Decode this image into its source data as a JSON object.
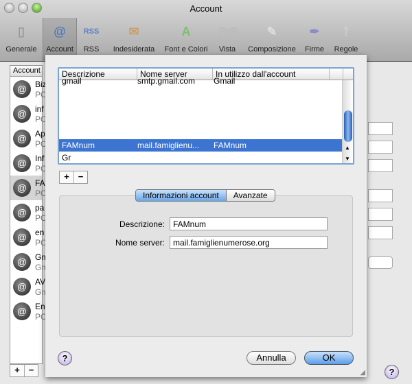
{
  "window": {
    "title": "Account"
  },
  "toolbar": [
    {
      "label": "Generale",
      "icon": "switch-icon",
      "glyph": "▯",
      "color": "#999"
    },
    {
      "label": "Account",
      "icon": "at-icon",
      "glyph": "@",
      "color": "#4a78c0",
      "selected": true
    },
    {
      "label": "RSS",
      "icon": "rss-icon",
      "glyph": "RSS",
      "color": "#5e7ec8"
    },
    {
      "label": "Indesiderata",
      "icon": "junk-bag-icon",
      "glyph": "✉",
      "color": "#c9a06a"
    },
    {
      "label": "Font e Colori",
      "icon": "font-colors-icon",
      "glyph": "A",
      "color": "#7cc06a"
    },
    {
      "label": "Vista",
      "icon": "view-glasses-icon",
      "glyph": "◎◎",
      "color": "#bbb"
    },
    {
      "label": "Composizione",
      "icon": "compose-pencil-icon",
      "glyph": "✎",
      "color": "#ddd"
    },
    {
      "label": "Firme",
      "icon": "signature-pen-icon",
      "glyph": "✒",
      "color": "#8a8ac8"
    },
    {
      "label": "Regole",
      "icon": "rules-icon",
      "glyph": "⇡",
      "color": "#ccc"
    }
  ],
  "sidebar": {
    "header": "Account",
    "items": [
      {
        "name": "Biz",
        "type": "PO"
      },
      {
        "name": "inf",
        "type": "PO"
      },
      {
        "name": "Ap",
        "type": "PO"
      },
      {
        "name": "Inf",
        "type": "PO"
      },
      {
        "name": "FA",
        "type": "PO",
        "selected": true
      },
      {
        "name": "pa",
        "type": "PO"
      },
      {
        "name": "en",
        "type": "PO"
      },
      {
        "name": "Gm",
        "type": "Gm"
      },
      {
        "name": "AV",
        "type": "Gm"
      },
      {
        "name": "En",
        "type": "PO"
      }
    ]
  },
  "sheet": {
    "table": {
      "columns": [
        "Descrizione",
        "Nome server",
        "In utilizzo dall'account"
      ],
      "rows": [
        [
          "gmail",
          "smtp.gmail.com",
          "Gmail"
        ],
        [
          "FAMnum",
          "mail.famiglienu...",
          "FAMnum"
        ],
        [
          "Gr",
          "",
          ""
        ]
      ],
      "selected_row": 1
    },
    "add": "+",
    "remove": "−",
    "tabs": [
      "Informazioni account",
      "Avanzate"
    ],
    "fields": {
      "descrizione_label": "Descrizione:",
      "descrizione_value": "FAMnum",
      "server_label": "Nome server:",
      "server_value": "mail.famiglienumerose.org"
    },
    "help": "?",
    "cancel": "Annulla",
    "ok": "OK"
  },
  "main": {
    "help": "?"
  }
}
